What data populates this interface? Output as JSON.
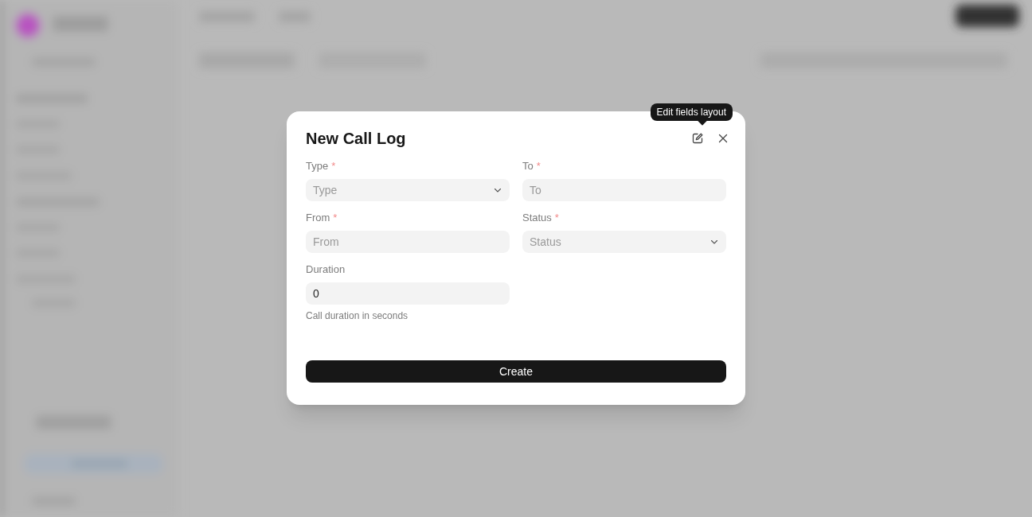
{
  "dialog": {
    "title": "New Call Log",
    "tooltip": "Edit fields layout",
    "required_mark": "*",
    "fields": [
      {
        "kind": "select",
        "label": "Type",
        "required": true,
        "placeholder": "Type"
      },
      {
        "kind": "text",
        "label": "To",
        "required": true,
        "placeholder": "To"
      },
      {
        "kind": "text",
        "label": "From",
        "required": true,
        "placeholder": "From"
      },
      {
        "kind": "select",
        "label": "Status",
        "required": true,
        "placeholder": "Status"
      },
      {
        "kind": "text",
        "label": "Duration",
        "required": false,
        "value": "0",
        "help": "Call duration in seconds"
      }
    ],
    "button": "Create"
  }
}
